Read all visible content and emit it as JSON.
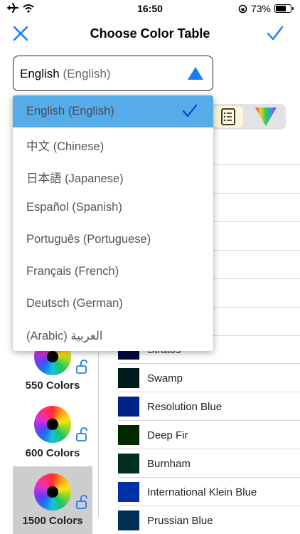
{
  "status_bar": {
    "time": "16:50",
    "battery": "73%",
    "battery_level": 0.73
  },
  "nav": {
    "title": "Choose Color Table"
  },
  "language_select": {
    "value": "English",
    "value_sub": "(English)"
  },
  "dropdown": {
    "options": [
      "English (English)",
      "中文 (Chinese)",
      "日本語  (Japanese)",
      "Español (Spanish)",
      "Português (Portuguese)",
      "Français (French)",
      "Deutsch (German)",
      "(Arabic) العربية"
    ],
    "selected_index": 0
  },
  "palettes": [
    {
      "label": "550 Colors",
      "selected": false
    },
    {
      "label": "600 Colors",
      "selected": false
    },
    {
      "label": "1500 Colors",
      "selected": true
    }
  ],
  "colors": [
    {
      "name": "Stratos",
      "hex": "#000741"
    },
    {
      "name": "Swamp",
      "hex": "#001b1c"
    },
    {
      "name": "Resolution Blue",
      "hex": "#002387"
    },
    {
      "name": "Deep Fir",
      "hex": "#002900"
    },
    {
      "name": "Burnham",
      "hex": "#002e20"
    },
    {
      "name": "International Klein Blue",
      "hex": "#002fa7"
    },
    {
      "name": "Prussian Blue",
      "hex": "#003153"
    }
  ],
  "accent_color": "#1a7cf5"
}
